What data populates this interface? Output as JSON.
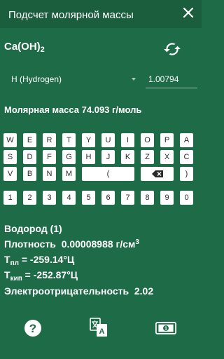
{
  "header": {
    "title": "Подсчет молярной массы",
    "close_icon": "close-icon"
  },
  "formula": {
    "base": "Ca(OH)",
    "subscript": "2"
  },
  "element_selector": {
    "selected": "H (Hydrogen)",
    "atomic_mass": "1.00794"
  },
  "molar_mass_text": "Молярная масса 74.093 г/моль",
  "keyboard": {
    "row1": [
      "W",
      "E",
      "R",
      "T",
      "Y",
      "U",
      "I",
      "O",
      "P",
      "A"
    ],
    "row2": [
      "S",
      "D",
      "F",
      "G",
      "H",
      "J",
      "K",
      "Z",
      "X",
      "C"
    ],
    "row3": [
      "V",
      "B",
      "N",
      "M",
      "(",
      ")"
    ],
    "row4": [
      "1",
      "2",
      "3",
      "4",
      "5",
      "6",
      "7",
      "8",
      "9",
      "0"
    ],
    "backspace_icon": "backspace-icon"
  },
  "element_info": {
    "name": "Водород (1)",
    "density_label": "Плотность",
    "density_value": "0.00008988 г/см",
    "density_unit_sup": "3",
    "melting_label": "T",
    "melting_sub": "пл",
    "melting_value": " =  -259.14°Ц",
    "boiling_label": "T",
    "boiling_sub": "кип",
    "boiling_value": " =  -252.87°Ц",
    "electronegativity_label": "Электроотрицательность",
    "electronegativity_value": "2.02"
  },
  "bottom_bar": {
    "help_icon": "help-icon",
    "translate_icon": "translate-icon",
    "money_icon": "money-icon"
  },
  "colors": {
    "background": "#1e6b47",
    "titlebar": "#1a5e3e",
    "key_background": "#ffffff",
    "text": "#ffffff"
  }
}
